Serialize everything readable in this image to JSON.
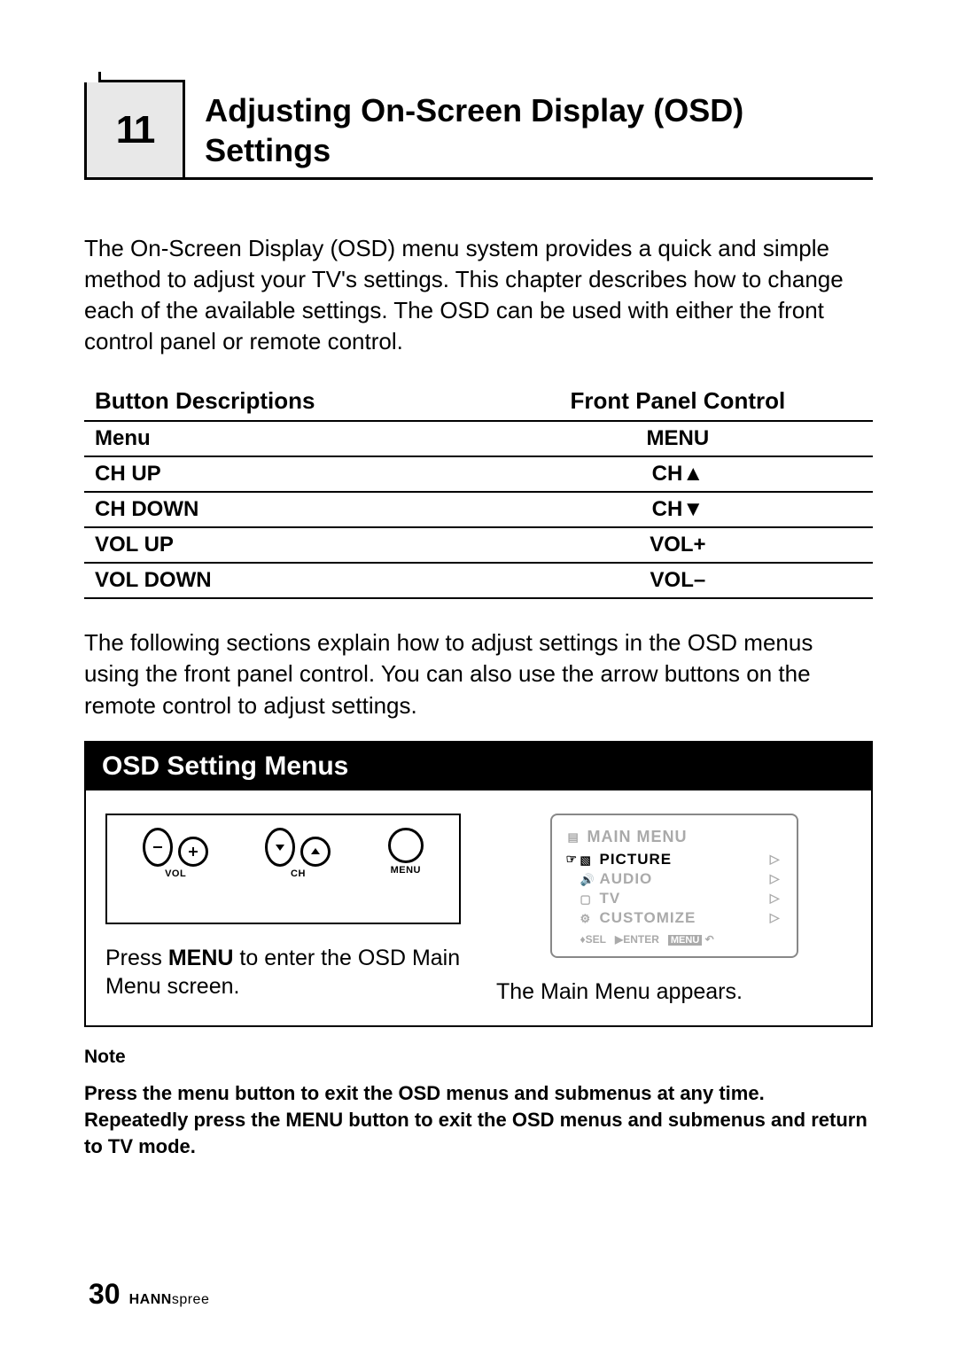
{
  "chapter": {
    "number": "11",
    "title": "Adjusting On-Screen Display (OSD) Settings"
  },
  "intro": "The On-Screen Display (OSD) menu system provides a quick and simple method to adjust your TV's settings. This chapter describes how to change each of the available settings. The OSD can be used with either the front control panel or remote control.",
  "table": {
    "headers": {
      "left": "Button Descriptions",
      "right": "Front Panel Control"
    },
    "rows": [
      {
        "desc": "Menu",
        "control": "MENU"
      },
      {
        "desc": "CH UP",
        "control": "CH▲"
      },
      {
        "desc": "CH DOWN",
        "control": "CH▼"
      },
      {
        "desc": "VOL UP",
        "control": "VOL+"
      },
      {
        "desc": "VOL DOWN",
        "control": "VOL–"
      }
    ]
  },
  "para2": "The following sections explain how to adjust settings in the OSD menus using the front panel control. You can also use the arrow buttons on the remote control to adjust settings.",
  "osd": {
    "header": "OSD Setting Menus",
    "panel": {
      "labels": {
        "vol": "VOL",
        "ch": "CH",
        "menu": "MENU"
      }
    },
    "left_caption_pre": "Press ",
    "left_caption_bold": "MENU",
    "left_caption_post": " to enter the OSD Main Menu screen.",
    "right_caption": "The Main Menu appears.",
    "menu_screen": {
      "title": "MAIN  MENU",
      "items": [
        {
          "label": "PICTURE",
          "active": true
        },
        {
          "label": "AUDIO",
          "active": false
        },
        {
          "label": "TV",
          "active": false
        },
        {
          "label": "CUSTOMIZE",
          "active": false
        }
      ],
      "footer": {
        "sel": "SEL",
        "enter": "ENTER",
        "menu": "MENU"
      }
    }
  },
  "note": {
    "label": "Note",
    "text": "Press the menu button to exit the OSD menus and submenus at any time. Repeatedly press the MENU button to exit the OSD menus and submenus and return to TV mode."
  },
  "footer": {
    "page": "30",
    "brand_bold": "HANN",
    "brand_rest": "spree"
  }
}
